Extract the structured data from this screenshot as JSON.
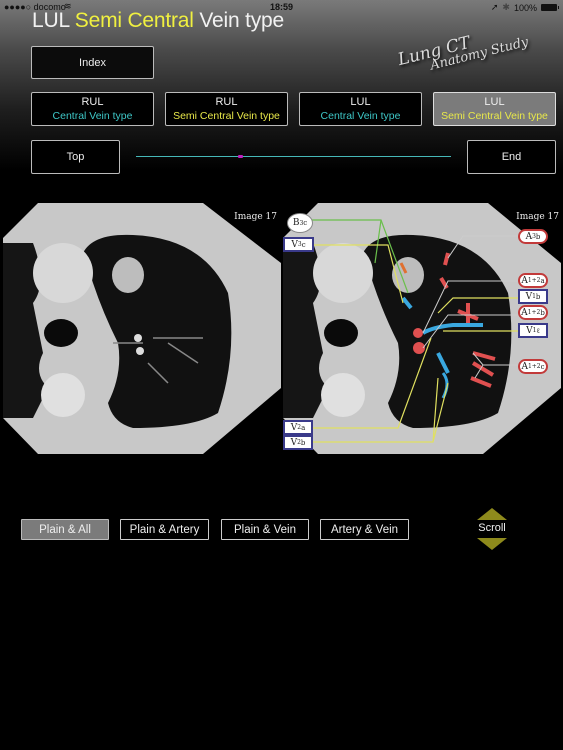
{
  "status_bar": {
    "carrier": "●●●●○ docomo",
    "wifi_icon": "wifi-icon",
    "time": "18:59",
    "location_icon": "location-arrow-icon",
    "bluetooth_icon": "bluetooth-icon",
    "battery": "100%"
  },
  "header": {
    "title_part1": "LUL ",
    "title_part2": "Semi Central",
    "title_part3": " Vein type",
    "logo_line1": "Lung CT",
    "logo_line2": "Anatomy Study"
  },
  "nav": {
    "index_label": "Index",
    "categories": [
      {
        "line1": "RUL",
        "line2": "Central Vein type",
        "accent": "#3ec7c7",
        "selected": false
      },
      {
        "line1": "RUL",
        "line2": "Semi Central Vein type",
        "accent": "#e8e84a",
        "selected": false
      },
      {
        "line1": "LUL",
        "line2": "Central Vein type",
        "accent": "#3ec7c7",
        "selected": false
      },
      {
        "line1": "LUL",
        "line2": "Semi Central Vein type",
        "accent": "#e8e84a",
        "selected": true
      }
    ],
    "top_label": "Top",
    "end_label": "End",
    "slider_fraction": 0.33
  },
  "images": {
    "left_label": "Image 17",
    "right_label": "Image 17",
    "annotations": {
      "b3c": {
        "base": "B",
        "sup": "3",
        "sub": "c"
      },
      "v3c": {
        "base": "V",
        "sup": "3",
        "sub": "c"
      },
      "a3b": {
        "base": "A",
        "sup": "3",
        "sub": "b"
      },
      "a12a": {
        "base": "A",
        "sup": "1+2",
        "sub": "a"
      },
      "v1b": {
        "base": "V",
        "sup": "1",
        "sub": "b"
      },
      "a12b": {
        "base": "A",
        "sup": "1+2",
        "sub": "b"
      },
      "v1l": {
        "base": "V",
        "sup": "1",
        "sub": "ℓ"
      },
      "a12c": {
        "base": "A",
        "sup": "1+2",
        "sub": "c"
      },
      "v2a": {
        "base": "V",
        "sup": "2",
        "sub": "a"
      },
      "v2b": {
        "base": "V",
        "sup": "2",
        "sub": "b"
      }
    },
    "colors": {
      "artery": "#e05050",
      "vein": "#3aa8e0",
      "bronchus": "#6abf4b",
      "leader_vein": "#e0e060",
      "leader_artery": "#cccccc"
    }
  },
  "view_modes": [
    {
      "label": "Plain & All",
      "selected": true
    },
    {
      "label": "Plain & Artery",
      "selected": false
    },
    {
      "label": "Plain & Vein",
      "selected": false
    },
    {
      "label": "Artery & Vein",
      "selected": false
    }
  ],
  "scroll_label": "Scroll"
}
